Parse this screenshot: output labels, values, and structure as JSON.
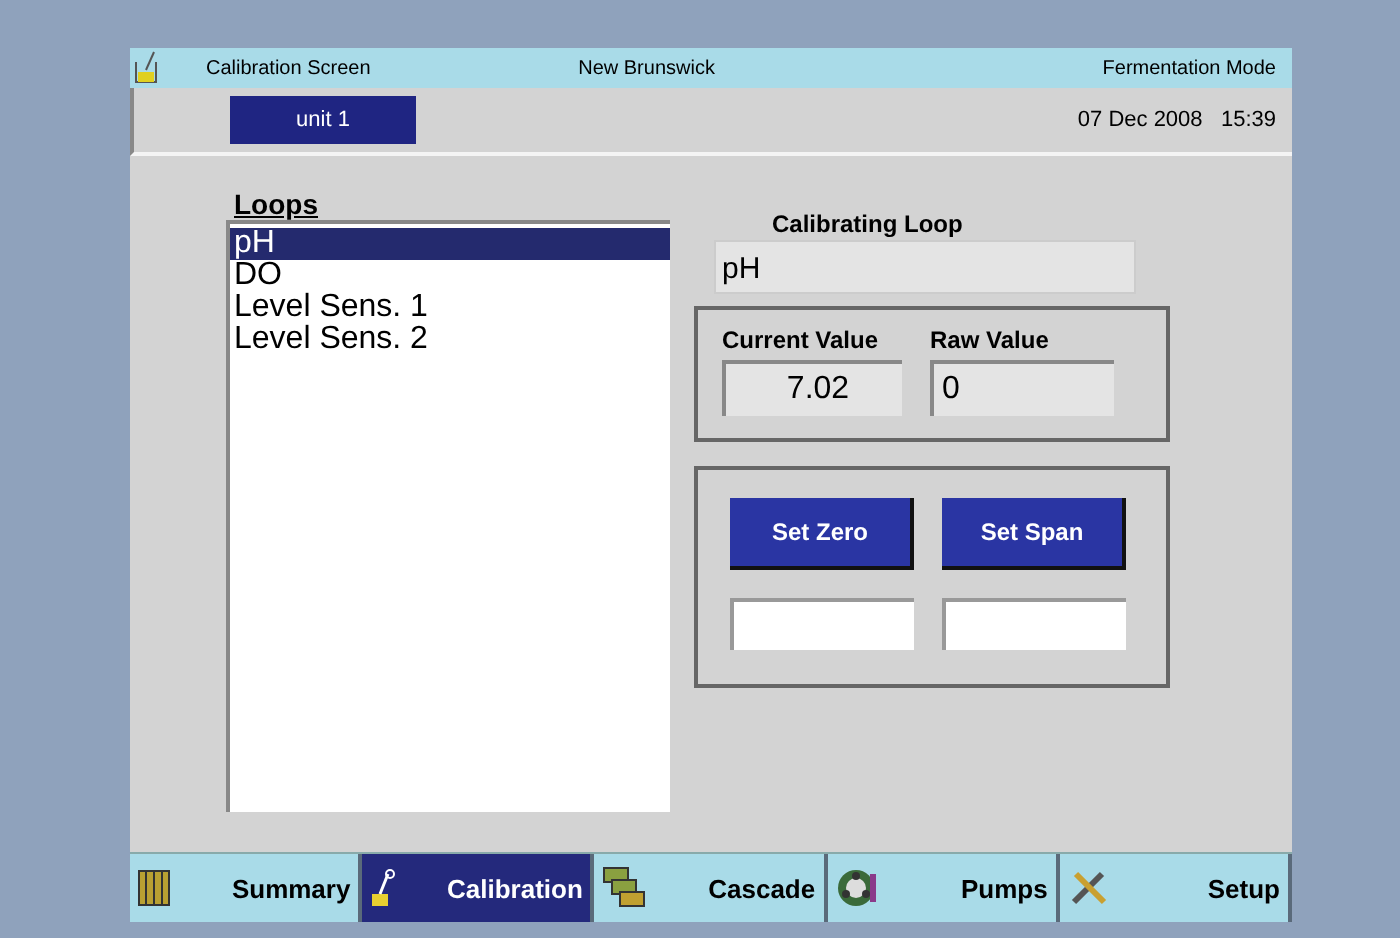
{
  "header": {
    "title": "Calibration Screen",
    "company": "New Brunswick",
    "mode": "Fermentation Mode"
  },
  "subbar": {
    "unit": "unit 1",
    "date": "07 Dec 2008",
    "time": "15:39"
  },
  "loops": {
    "heading": "Loops",
    "items": [
      {
        "label": "pH",
        "selected": true
      },
      {
        "label": "DO",
        "selected": false
      },
      {
        "label": "Level Sens. 1",
        "selected": false
      },
      {
        "label": "Level Sens. 2",
        "selected": false
      }
    ]
  },
  "calibrating_loop": {
    "label": "Calibrating Loop",
    "value": "pH"
  },
  "readings": [
    {
      "label": "Current Value",
      "value": "7.02"
    },
    {
      "label": "Raw Value",
      "value": "0"
    }
  ],
  "actions": [
    {
      "label": "Set Zero"
    },
    {
      "label": "Set Span"
    }
  ],
  "tabs": [
    {
      "label": "Summary",
      "selected": false
    },
    {
      "label": "Calibration",
      "selected": true
    },
    {
      "label": "Cascade",
      "selected": false
    },
    {
      "label": "Pumps",
      "selected": false
    },
    {
      "label": "Setup",
      "selected": false
    }
  ]
}
